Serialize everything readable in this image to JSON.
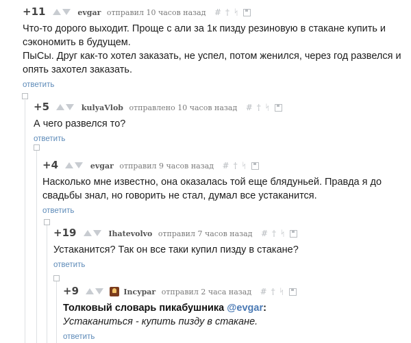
{
  "comments": [
    {
      "rating": "+11",
      "author": "evgar",
      "meta": "отправил 10 часов назад",
      "lines": [
        "Что-то дорого выходит. Проще с али за 1к пизду резиновую в стакане купить и",
        "сэкономить в будущем.",
        "ПыСы. Друг как-то хотел заказать, не успел, потом женился, через год развелся и",
        "опять захотел заказать."
      ],
      "reply": "ответить"
    },
    {
      "rating": "+5",
      "author": "kulyaVlob",
      "meta": "отправлено 10 часов назад",
      "lines": [
        "А чего развелся то?"
      ],
      "reply": "ответить"
    },
    {
      "rating": "+4",
      "author": "evgar",
      "meta": "отправил 9 часов назад",
      "lines": [
        "Насколько мне известно, она оказалась той еще блядуньей. Правда я до",
        "свадьбы знал, но говорить не стал, думал все устаканится."
      ],
      "reply": "ответить"
    },
    {
      "rating": "+19",
      "author": "Ihatevolvo",
      "meta": "отправил 7 часов назад",
      "lines": [
        "Устаканится? Так он все таки купил пизду в стакане?"
      ],
      "reply": "ответить"
    },
    {
      "rating": "+9",
      "author": "Incypar",
      "meta": "отправил 2 часа назад",
      "title_bold": "Толковый словарь пикабушника",
      "mention": "@evgar",
      "colon": ":",
      "italic_term": "Устаканиться",
      "italic_rest": " - купить пизду в стакане.",
      "reply": "ответить"
    }
  ],
  "colors": {
    "link": "#5c8ab8",
    "text": "#1c1c1c",
    "meta": "#7a7a7a",
    "icons": "#b8bcc0"
  },
  "icons": [
    "hash-icon",
    "dagger-icon",
    "branch-icon",
    "save-icon",
    "vote-up-icon",
    "vote-down-icon"
  ]
}
